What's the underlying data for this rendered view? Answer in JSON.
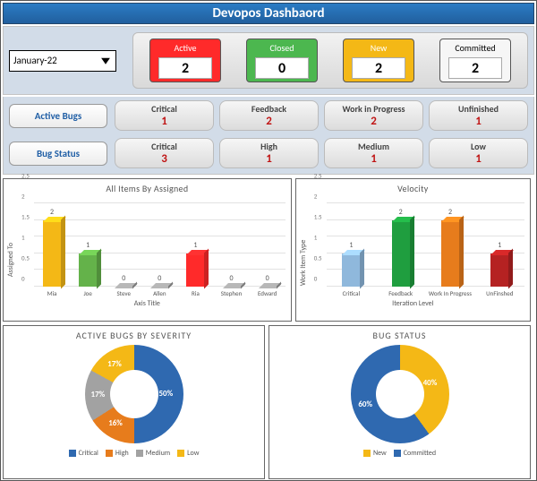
{
  "title": "Devopos Dashbaord",
  "month_select": {
    "value": "January-22"
  },
  "status_cards": {
    "active": {
      "label": "Active",
      "value": "2"
    },
    "closed": {
      "label": "Closed",
      "value": "0"
    },
    "new": {
      "label": "New",
      "value": "2"
    },
    "committed": {
      "label": "Committed",
      "value": "2"
    }
  },
  "rows": {
    "active_bugs": {
      "label": "Active Bugs",
      "items": [
        {
          "label": "Critical",
          "value": "1"
        },
        {
          "label": "Feedback",
          "value": "2"
        },
        {
          "label": "Work in Progress",
          "value": "2"
        },
        {
          "label": "Unfinished",
          "value": "1"
        }
      ]
    },
    "bug_status": {
      "label": "Bug Status",
      "items": [
        {
          "label": "Critical",
          "value": "3"
        },
        {
          "label": "High",
          "value": "1"
        },
        {
          "label": "Medium",
          "value": "1"
        },
        {
          "label": "Low",
          "value": "1"
        }
      ]
    }
  },
  "chart_data": [
    {
      "type": "bar",
      "title": "All Items By Assigned",
      "xlabel": "Axis Title",
      "ylabel": "Assigned To",
      "ylim": [
        0,
        2.5
      ],
      "categories": [
        "Mia",
        "Joe",
        "Steve",
        "Allen",
        "Ria",
        "Stephen",
        "Edward"
      ],
      "values": [
        2,
        1,
        0,
        0,
        1,
        0,
        0
      ],
      "colors": [
        "#f4b816",
        "#64b24a",
        "#999999",
        "#999999",
        "#ff2a2a",
        "#999999",
        "#999999"
      ]
    },
    {
      "type": "bar",
      "title": "Velocity",
      "xlabel": "Iteration Level",
      "ylabel": "Work Item Type",
      "ylim": [
        0,
        2.5
      ],
      "categories": [
        "Critical",
        "Feedback",
        "Work In Progress",
        "UnFinshed"
      ],
      "values": [
        1,
        2,
        2,
        1
      ],
      "colors": [
        "#8fb8dc",
        "#1f9e3f",
        "#e77c1c",
        "#b52222"
      ]
    },
    {
      "type": "pie",
      "title": "ACTIVE BUGS BY SEVERITY",
      "series": [
        {
          "name": "Critical",
          "value": 50,
          "label": "50%",
          "color": "#2f69b0"
        },
        {
          "name": "High",
          "value": 16,
          "label": "16%",
          "color": "#e77c1c"
        },
        {
          "name": "Medium",
          "value": 17,
          "label": "17%",
          "color": "#a2a2a2"
        },
        {
          "name": "Low",
          "value": 17,
          "label": "17%",
          "color": "#f4b816"
        }
      ],
      "hole": true
    },
    {
      "type": "pie",
      "title": "BUG STATUS",
      "series": [
        {
          "name": "New",
          "value": 40,
          "label": "40%",
          "color": "#f4b816"
        },
        {
          "name": "Committed",
          "value": 60,
          "label": "60%",
          "color": "#2f69b0"
        }
      ],
      "hole": true
    }
  ]
}
